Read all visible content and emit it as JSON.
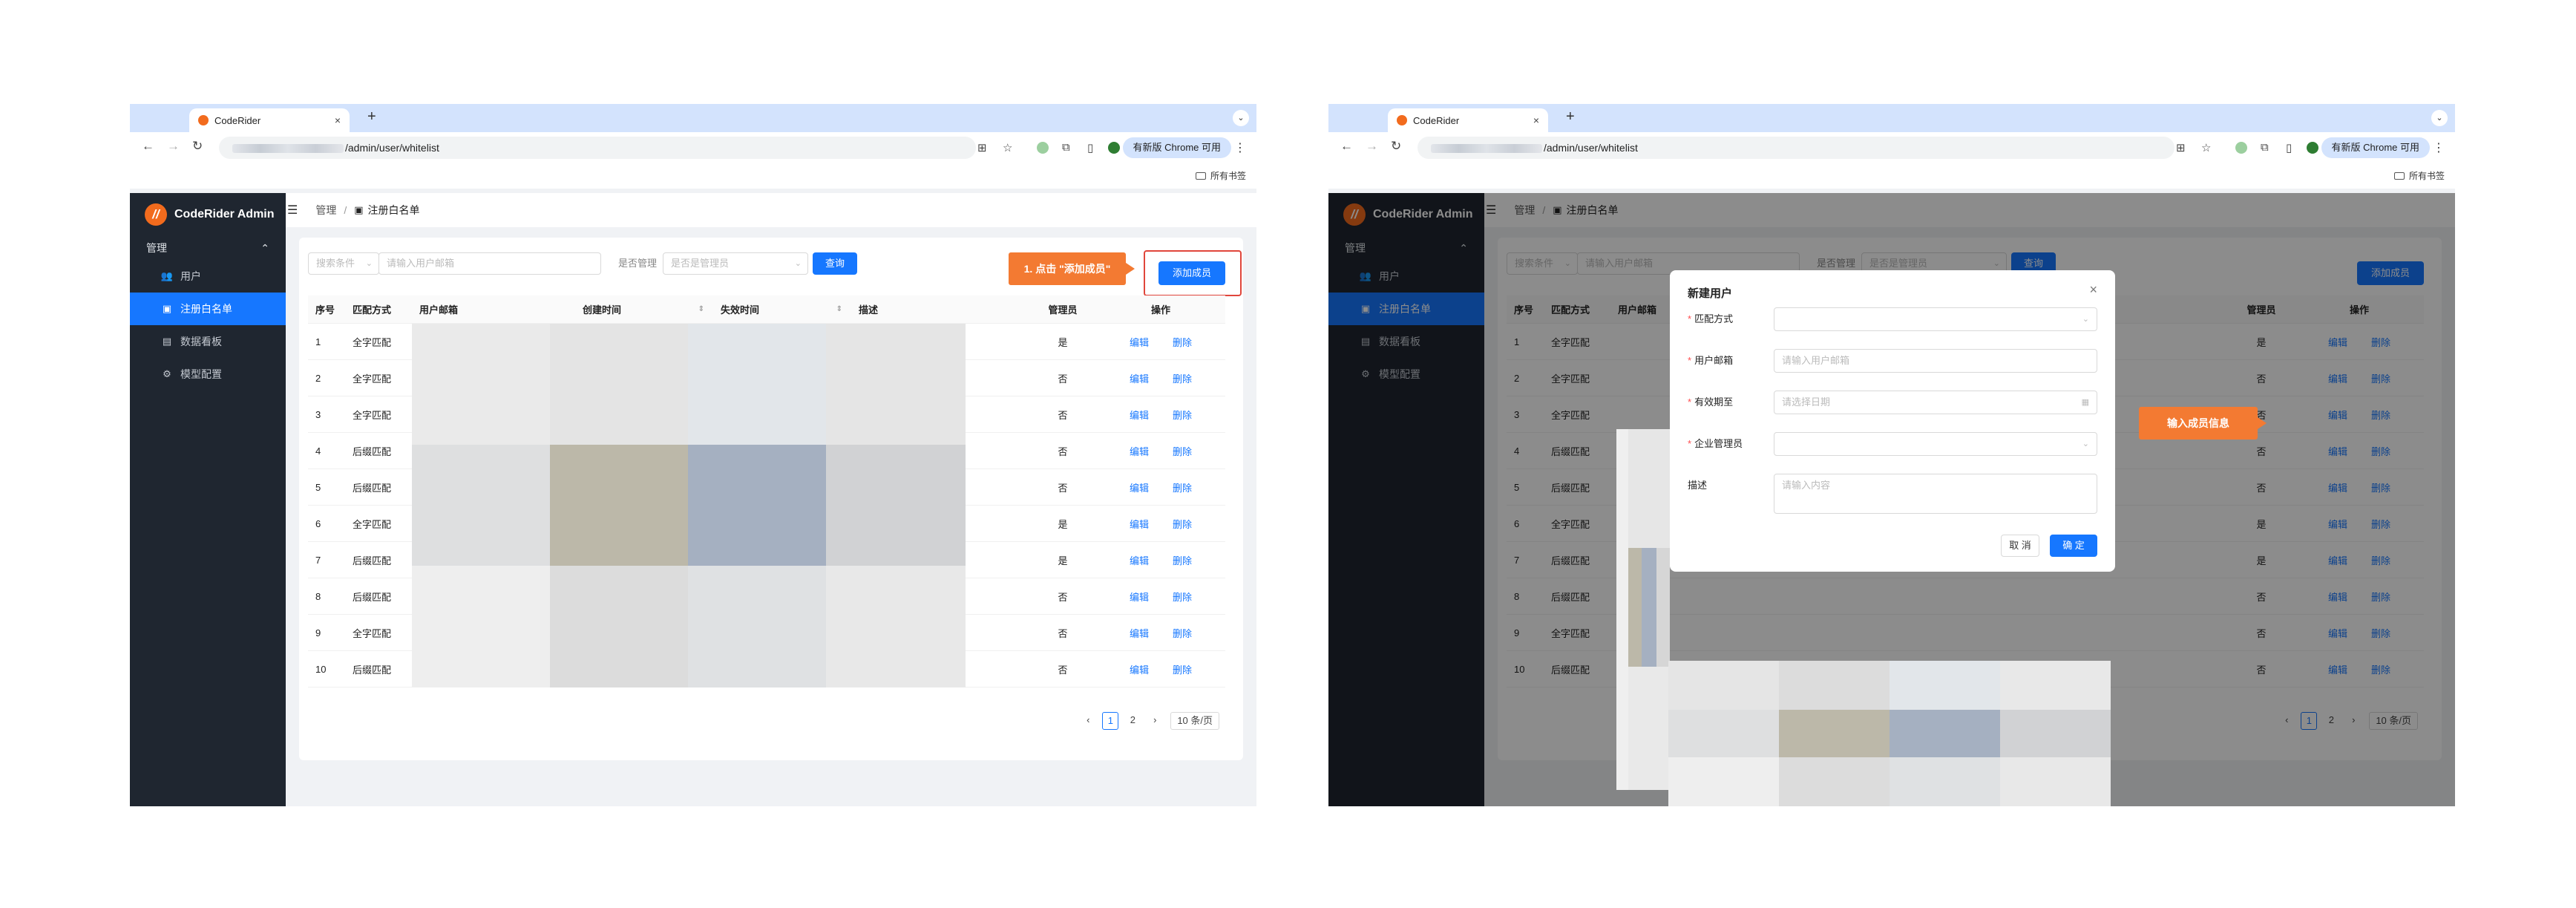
{
  "browser": {
    "tab_title": "CodeRider",
    "tab_close": "×",
    "new_tab": "+",
    "tab_menu": "⌄",
    "url_path": "/admin/user/whitelist",
    "update_pill": "有新版 Chrome 可用",
    "update_menu": "⋮",
    "bookmarks_all": "所有书签",
    "nav_back": "←",
    "nav_forward": "→",
    "nav_reload": "↻",
    "translate_icon": "⊞",
    "star_icon": "☆",
    "extension_icon": "⧉",
    "sidepanel_icon": "▯"
  },
  "sidebar": {
    "brand": "CodeRider Admin",
    "brand_logo": "//",
    "group": "管理",
    "group_chevron": "⌃",
    "items": [
      {
        "label": "用户",
        "icon": "👥"
      },
      {
        "label": "注册白名单",
        "icon": "▣"
      },
      {
        "label": "数据看板",
        "icon": "▤"
      },
      {
        "label": "模型配置",
        "icon": "⚙"
      }
    ]
  },
  "header": {
    "hamburger": "☰",
    "breadcrumb_root": "管理",
    "breadcrumb_sep": "/",
    "breadcrumb_icon": "▣",
    "breadcrumb_current": "注册白名单"
  },
  "filter": {
    "condition_placeholder": "搜索条件",
    "email_placeholder": "请输入用户邮箱",
    "admin_label": "是否管理",
    "admin_placeholder": "是否是管理员",
    "query_button": "查询",
    "add_button": "添加成员",
    "chevron": "⌄"
  },
  "table": {
    "columns": [
      "序号",
      "匹配方式",
      "用户邮箱",
      "创建时间",
      "失效时间",
      "描述",
      "管理员",
      "操作"
    ],
    "sort_icon": "⇕",
    "edit": "编辑",
    "delete": "删除",
    "rows": [
      {
        "idx": "1",
        "match": "全字匹配",
        "admin": "是"
      },
      {
        "idx": "2",
        "match": "全字匹配",
        "admin": "否"
      },
      {
        "idx": "3",
        "match": "全字匹配",
        "admin": "否"
      },
      {
        "idx": "4",
        "match": "后缀匹配",
        "admin": "否"
      },
      {
        "idx": "5",
        "match": "后缀匹配",
        "admin": "否"
      },
      {
        "idx": "6",
        "match": "全字匹配",
        "admin": "是"
      },
      {
        "idx": "7",
        "match": "后缀匹配",
        "admin": "是"
      },
      {
        "idx": "8",
        "match": "后缀匹配",
        "admin": "否"
      },
      {
        "idx": "9",
        "match": "全字匹配",
        "admin": "否"
      },
      {
        "idx": "10",
        "match": "后缀匹配",
        "admin": "否"
      }
    ]
  },
  "pager": {
    "prev": "‹",
    "next": "›",
    "pages": [
      "1",
      "2"
    ],
    "page_size": "10 条/页"
  },
  "callouts": {
    "step1": "1. 点击 \"添加成员\"",
    "step2": "输入成员信息"
  },
  "modal": {
    "title": "新建用户",
    "close": "×",
    "fields": [
      {
        "label": "匹配方式",
        "required": true,
        "placeholder": "",
        "kind": "select"
      },
      {
        "label": "用户邮箱",
        "required": true,
        "placeholder": "请输入用户邮箱",
        "kind": "input"
      },
      {
        "label": "有效期至",
        "required": true,
        "placeholder": "请选择日期",
        "kind": "date"
      },
      {
        "label": "企业管理员",
        "required": true,
        "placeholder": "",
        "kind": "select"
      },
      {
        "label": "描述",
        "required": false,
        "placeholder": "请输入内容",
        "kind": "textarea"
      }
    ],
    "required_mark": "*",
    "calendar_icon": "▦",
    "cancel": "取 消",
    "ok": "确 定"
  },
  "colors": {
    "primary": "#1677ff",
    "sidebar_bg": "#1f2630",
    "callout": "#f37a32",
    "highlight_border": "#e0463b"
  }
}
